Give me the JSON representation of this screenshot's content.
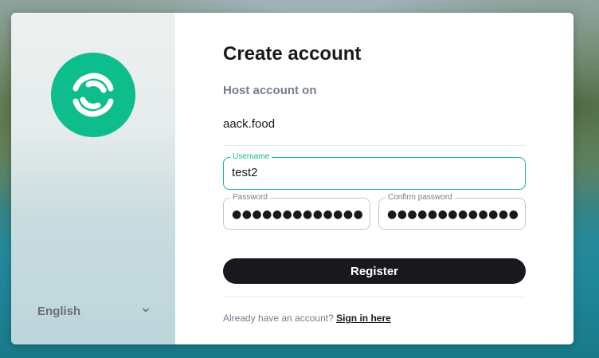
{
  "language": {
    "selected": "English",
    "chevron_icon": "chevron-down-icon"
  },
  "logo": {
    "icon": "element-logo-icon",
    "color": "#0dbd8b"
  },
  "form": {
    "title": "Create account",
    "host_label": "Host account on",
    "host_value": "aack.food",
    "username": {
      "label": "Username",
      "value": "test2"
    },
    "password": {
      "label": "Password",
      "value": "●●●●●●●●●●●●●"
    },
    "confirm_password": {
      "label": "Confirm password",
      "value": "●●●●●●●●●●●●●"
    },
    "register_label": "Register",
    "footer_prompt": "Already have an account?",
    "sign_in_link": "Sign in here"
  },
  "colors": {
    "accent": "#0dbd8b",
    "button": "#17191c",
    "muted_text": "#737d8c"
  }
}
